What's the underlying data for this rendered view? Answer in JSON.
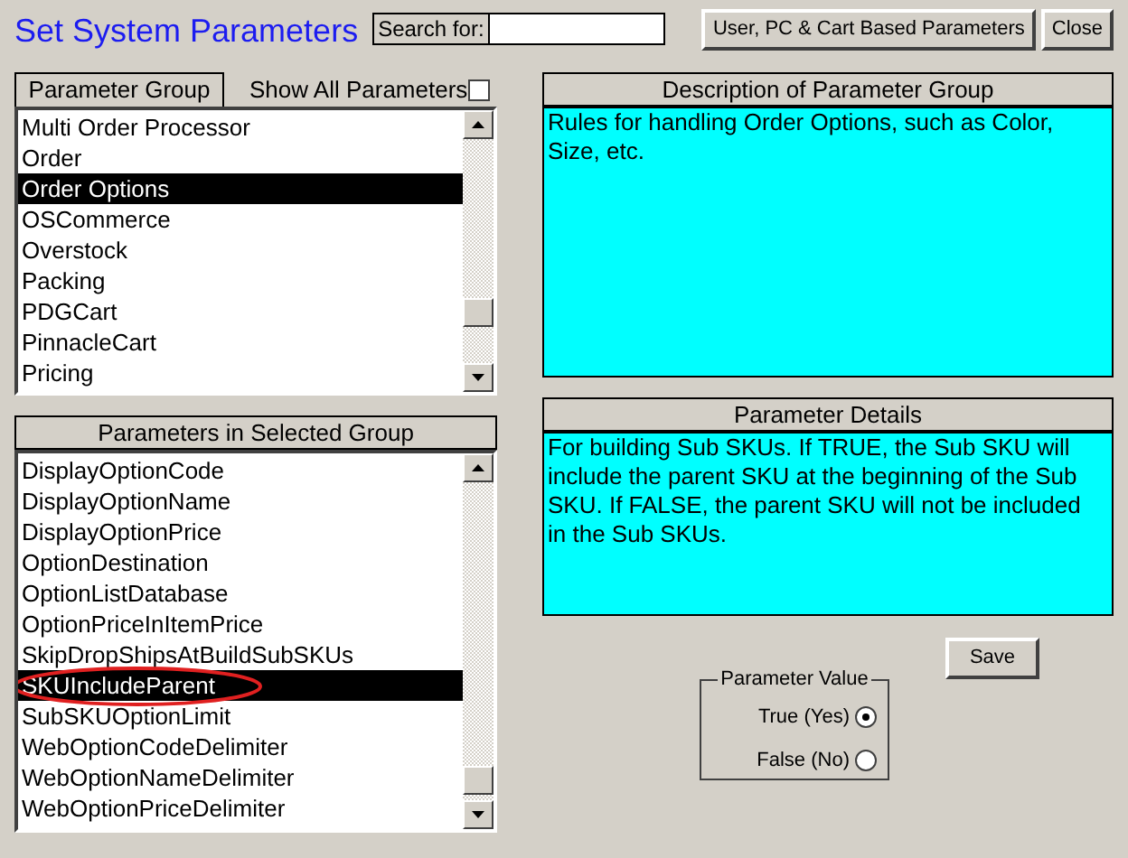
{
  "title": "Set System Parameters",
  "search": {
    "label": "Search for:"
  },
  "buttons": [
    {
      "label": "User, PC & Cart Based Parameters"
    },
    {
      "label": "Close"
    }
  ],
  "group_panel": {
    "header": "Parameter Group",
    "show_all": {
      "label": "Show All Parameters",
      "checked": false
    },
    "items": [
      {
        "label": "Multi Order Processor",
        "selected": false
      },
      {
        "label": "Order",
        "selected": false
      },
      {
        "label": "Order Options",
        "selected": true
      },
      {
        "label": "OSCommerce",
        "selected": false
      },
      {
        "label": "Overstock",
        "selected": false
      },
      {
        "label": "Packing",
        "selected": false
      },
      {
        "label": "PDGCart",
        "selected": false
      },
      {
        "label": "PinnacleCart",
        "selected": false
      },
      {
        "label": "Pricing",
        "selected": false
      }
    ]
  },
  "description": {
    "header": "Description of Parameter Group",
    "text": "Rules for handling Order Options, such as Color, Size, etc."
  },
  "parameters_panel": {
    "header": "Parameters in Selected Group",
    "items": [
      {
        "label": "DisplayOptionCode",
        "selected": false,
        "circled": false
      },
      {
        "label": "DisplayOptionName",
        "selected": false,
        "circled": false
      },
      {
        "label": "DisplayOptionPrice",
        "selected": false,
        "circled": false
      },
      {
        "label": "OptionDestination",
        "selected": false,
        "circled": false
      },
      {
        "label": "OptionListDatabase",
        "selected": false,
        "circled": false
      },
      {
        "label": "OptionPriceInItemPrice",
        "selected": false,
        "circled": false
      },
      {
        "label": "SkipDropShipsAtBuildSubSKUs",
        "selected": false,
        "circled": false
      },
      {
        "label": "SKUIncludeParent",
        "selected": true,
        "circled": true
      },
      {
        "label": "SubSKUOptionLimit",
        "selected": false,
        "circled": false
      },
      {
        "label": "WebOptionCodeDelimiter",
        "selected": false,
        "circled": false
      },
      {
        "label": "WebOptionNameDelimiter",
        "selected": false,
        "circled": false
      },
      {
        "label": "WebOptionPriceDelimiter",
        "selected": false,
        "circled": false
      }
    ]
  },
  "details": {
    "header": "Parameter Details",
    "text": "For building Sub SKUs. If TRUE, the Sub SKU will include the parent SKU at the beginning of the Sub SKU. If FALSE, the parent SKU will not be included in the Sub SKUs."
  },
  "save_button": {
    "label": "Save"
  },
  "parameter_value": {
    "legend": "Parameter Value",
    "options": [
      {
        "label": "True (Yes)",
        "selected": true
      },
      {
        "label": "False (No)",
        "selected": false
      }
    ]
  }
}
